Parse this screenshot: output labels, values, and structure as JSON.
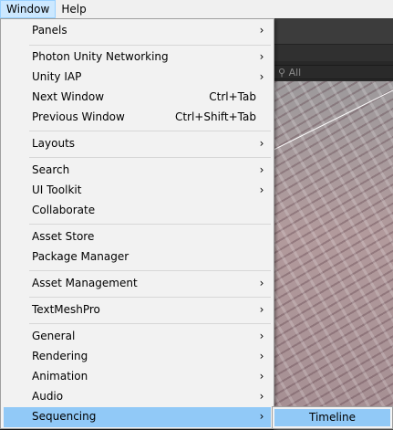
{
  "menubar": {
    "items": [
      {
        "label": "Window",
        "active": true
      },
      {
        "label": "Help",
        "active": false
      }
    ]
  },
  "editor": {
    "search_placeholder": "All"
  },
  "window_menu": {
    "items": [
      {
        "label": "Panels",
        "shortcut": "",
        "submenu": true
      },
      {
        "label": "Photon Unity Networking",
        "shortcut": "",
        "submenu": true
      },
      {
        "label": "Unity IAP",
        "shortcut": "",
        "submenu": true
      },
      {
        "label": "Next Window",
        "shortcut": "Ctrl+Tab",
        "submenu": false
      },
      {
        "label": "Previous Window",
        "shortcut": "Ctrl+Shift+Tab",
        "submenu": false
      },
      {
        "label": "Layouts",
        "shortcut": "",
        "submenu": true
      },
      {
        "label": "Search",
        "shortcut": "",
        "submenu": true
      },
      {
        "label": "UI Toolkit",
        "shortcut": "",
        "submenu": true
      },
      {
        "label": "Collaborate",
        "shortcut": "",
        "submenu": false
      },
      {
        "label": "Asset Store",
        "shortcut": "",
        "submenu": false
      },
      {
        "label": "Package Manager",
        "shortcut": "",
        "submenu": false
      },
      {
        "label": "Asset Management",
        "shortcut": "",
        "submenu": true
      },
      {
        "label": "TextMeshPro",
        "shortcut": "",
        "submenu": true
      },
      {
        "label": "General",
        "shortcut": "",
        "submenu": true
      },
      {
        "label": "Rendering",
        "shortcut": "",
        "submenu": true
      },
      {
        "label": "Animation",
        "shortcut": "",
        "submenu": true
      },
      {
        "label": "Audio",
        "shortcut": "",
        "submenu": true
      },
      {
        "label": "Sequencing",
        "shortcut": "",
        "submenu": true,
        "highlighted": true
      }
    ],
    "arrow_glyph": "›"
  },
  "submenu": {
    "items": [
      {
        "label": "Timeline",
        "highlighted": true
      }
    ]
  },
  "colors": {
    "highlight": "#91c9f7",
    "menu_bg": "#f2f2f2",
    "menubar_bg": "#f0f0f0"
  }
}
